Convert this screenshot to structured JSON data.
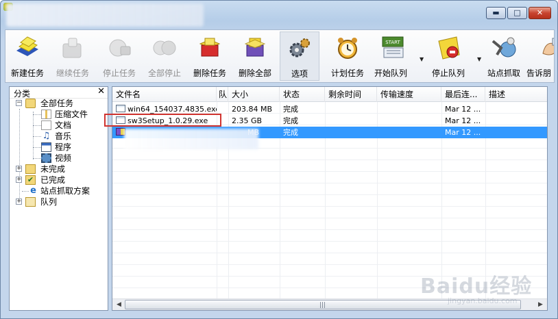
{
  "window": {
    "minimize_glyph": "▬",
    "maximize_glyph": "□",
    "close_glyph": "✕"
  },
  "toolbar": {
    "buttons": [
      {
        "label": "新建任务",
        "icon": "new-task-icon",
        "enabled": true
      },
      {
        "label": "继续任务",
        "icon": "resume-task-icon",
        "enabled": false
      },
      {
        "label": "停止任务",
        "icon": "stop-task-icon",
        "enabled": false
      },
      {
        "label": "全部停止",
        "icon": "stop-all-icon",
        "enabled": false
      },
      {
        "label": "删除任务",
        "icon": "delete-task-icon",
        "enabled": true
      },
      {
        "label": "删除全部",
        "icon": "delete-all-icon",
        "enabled": true
      },
      {
        "label": "选项",
        "icon": "options-gear-icon",
        "enabled": true
      },
      {
        "label": "计划任务",
        "icon": "schedule-clock-icon",
        "enabled": true
      },
      {
        "label": "开始队列",
        "icon": "start-queue-icon",
        "enabled": true
      },
      {
        "label": "停止队列",
        "icon": "stop-queue-icon",
        "enabled": true
      },
      {
        "label": "站点抓取",
        "icon": "site-grabber-icon",
        "enabled": true
      },
      {
        "label": "告诉朋",
        "icon": "tell-friend-icon",
        "enabled": true
      }
    ],
    "start_badge": "START"
  },
  "sidebar": {
    "title": "分类",
    "close_glyph": "✕",
    "tree": {
      "all_tasks": "全部任务",
      "compressed": "压缩文件",
      "documents": "文档",
      "music": "音乐",
      "programs": "程序",
      "video": "视频",
      "unfinished": "未完成",
      "finished": "已完成",
      "site_grab_plans": "站点抓取方案",
      "queue": "队列"
    }
  },
  "list": {
    "columns": [
      "文件名",
      "队",
      "大小",
      "状态",
      "剩余时间",
      "传输速度",
      "最后连...",
      "描述"
    ],
    "rows": [
      {
        "name": "win64_154037.4835.exe",
        "size": "203.84 MB",
        "status": "完成",
        "last": "Mar 12 ...",
        "selected": false
      },
      {
        "name": "sw3Setup_1.0.29.exe",
        "size": "2.35 GB",
        "status": "完成",
        "last": "Mar 12 ...",
        "selected": false
      },
      {
        "name": "",
        "size": "MB",
        "status": "完成",
        "last": "Mar 12 ...",
        "selected": true
      }
    ]
  },
  "scrollbar": {
    "left_glyph": "◀",
    "right_glyph": "▶",
    "grip": "|||"
  },
  "watermark": {
    "brand": "Baidu经验",
    "url": "jingyan.baidu.com"
  }
}
